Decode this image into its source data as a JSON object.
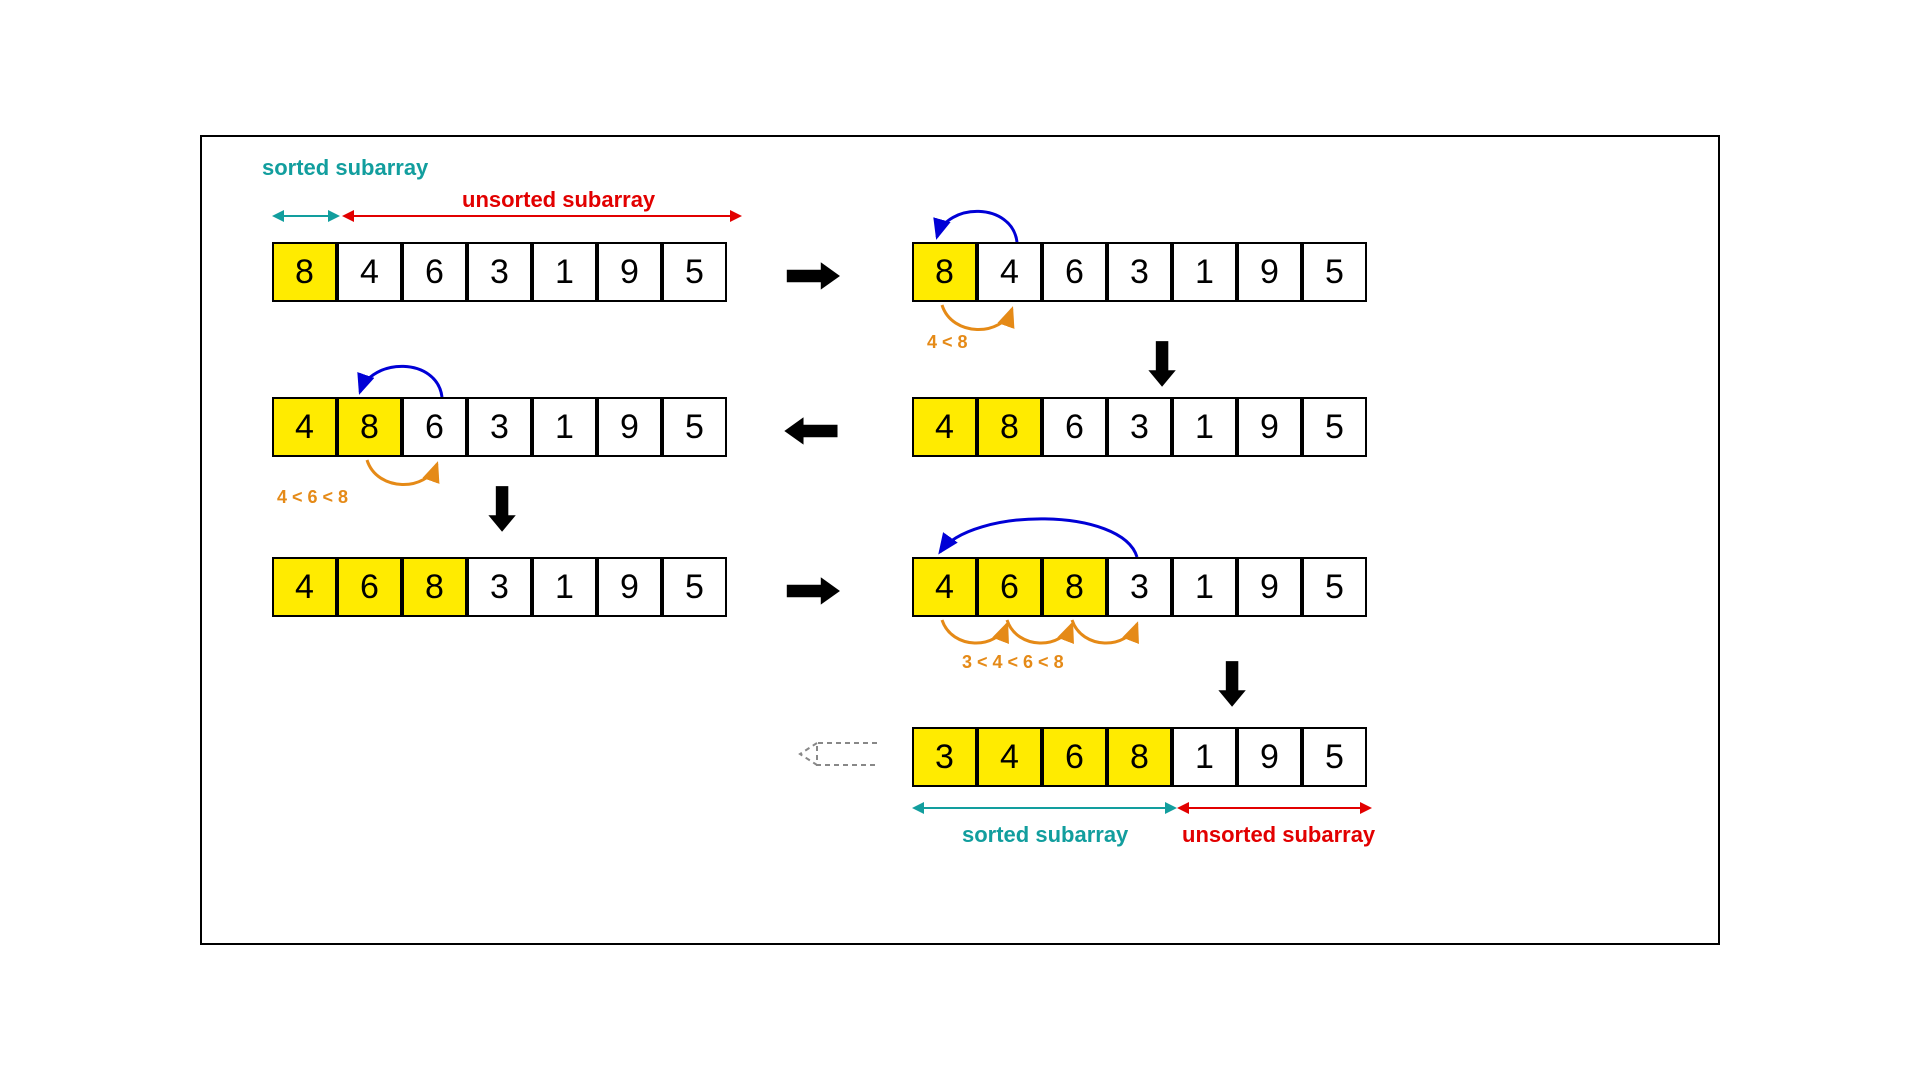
{
  "labels": {
    "sorted": "sorted subarray",
    "unsorted": "unsorted subarray"
  },
  "comparisons": {
    "step2": "4 < 8",
    "step3": "4 < 6 < 8",
    "step6": "3 < 4 < 6 < 8"
  },
  "steps": [
    {
      "values": [
        8,
        4,
        6,
        3,
        1,
        9,
        5
      ],
      "sorted_count": 1
    },
    {
      "values": [
        8,
        4,
        6,
        3,
        1,
        9,
        5
      ],
      "sorted_count": 1
    },
    {
      "values": [
        4,
        8,
        6,
        3,
        1,
        9,
        5
      ],
      "sorted_count": 2
    },
    {
      "values": [
        4,
        8,
        6,
        3,
        1,
        9,
        5
      ],
      "sorted_count": 2
    },
    {
      "values": [
        4,
        6,
        8,
        3,
        1,
        9,
        5
      ],
      "sorted_count": 3
    },
    {
      "values": [
        4,
        6,
        8,
        3,
        1,
        9,
        5
      ],
      "sorted_count": 3
    },
    {
      "values": [
        3,
        4,
        6,
        8,
        1,
        9,
        5
      ],
      "sorted_count": 4
    }
  ],
  "colors": {
    "sorted_fill": "#ffeb00",
    "teal": "#129e9e",
    "red": "#e20000",
    "orange": "#e58a17",
    "blue_arc": "#0000d6"
  }
}
